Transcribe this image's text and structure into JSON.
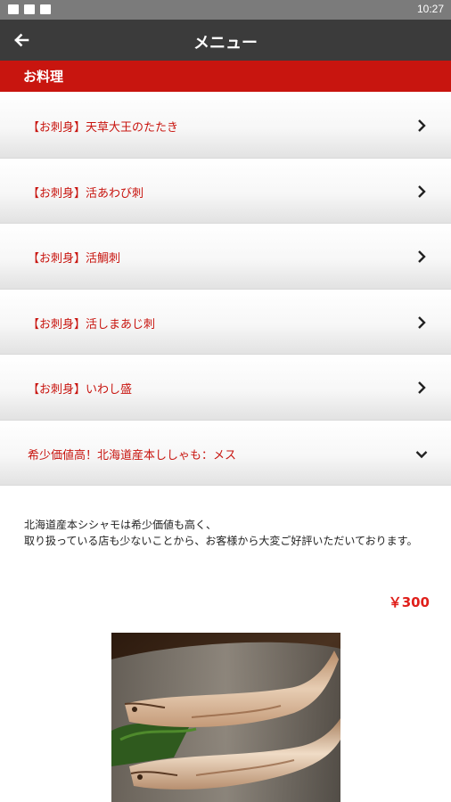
{
  "status_bar": {
    "time": "10:27"
  },
  "app_bar": {
    "title": "メニュー",
    "back_icon": "arrow-left-icon"
  },
  "section": {
    "title": "お料理"
  },
  "menu_items": [
    {
      "label": "【お刺身】天草大王のたたき",
      "icon": "chevron-right-icon"
    },
    {
      "label": "【お刺身】活あわび刺",
      "icon": "chevron-right-icon"
    },
    {
      "label": "【お刺身】活鯛刺",
      "icon": "chevron-right-icon"
    },
    {
      "label": "【お刺身】活しまあじ刺",
      "icon": "chevron-right-icon"
    },
    {
      "label": "【お刺身】いわし盛",
      "icon": "chevron-right-icon"
    },
    {
      "label": "希少価値高！北海道産本ししゃも：メス",
      "icon": "chevron-down-icon",
      "expanded": true
    }
  ],
  "detail": {
    "description_line1": "北海道産本シシャモは希少価値も高く、",
    "description_line2": "取り扱っている店も少ないことから、お客様から大変ご好評いただいております。",
    "price": "￥300"
  },
  "colors": {
    "accent_red": "#c8150f",
    "price_red": "#e0201b",
    "app_bar": "#3b3b3b",
    "status_bar": "#7b7b7b"
  }
}
